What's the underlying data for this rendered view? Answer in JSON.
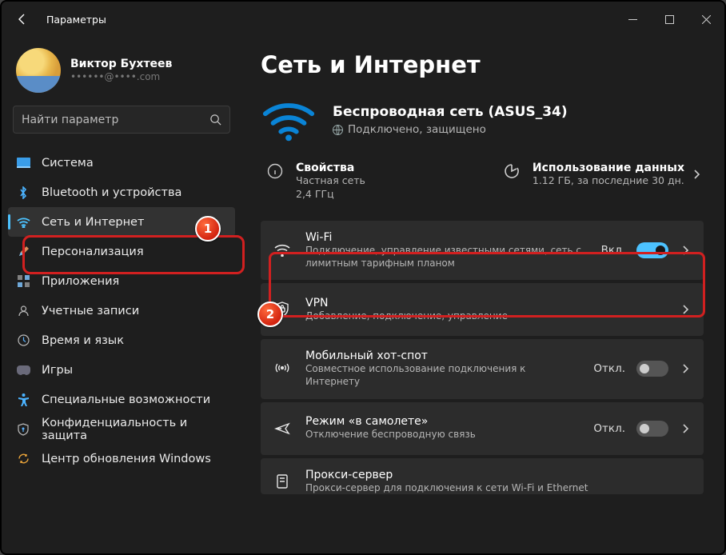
{
  "window": {
    "title": "Параметры"
  },
  "profile": {
    "name": "Виктор Бухтеев",
    "email": "••••••@••••.com"
  },
  "search": {
    "placeholder": "Найти параметр"
  },
  "sidebar": {
    "items": [
      {
        "label": "Система"
      },
      {
        "label": "Bluetooth и устройства"
      },
      {
        "label": "Сеть и Интернет"
      },
      {
        "label": "Персонализация"
      },
      {
        "label": "Приложения"
      },
      {
        "label": "Учетные записи"
      },
      {
        "label": "Время и язык"
      },
      {
        "label": "Игры"
      },
      {
        "label": "Специальные возможности"
      },
      {
        "label": "Конфиденциальность и защита"
      },
      {
        "label": "Центр обновления Windows"
      }
    ]
  },
  "main": {
    "title": "Сеть и Интернет",
    "hero": {
      "title": "Беспроводная сеть (ASUS_34)",
      "sub": "Подключено, защищено"
    },
    "props": {
      "left": {
        "title": "Свойства",
        "line1": "Частная сеть",
        "line2": "2,4 ГГц"
      },
      "right": {
        "title": "Использование данных",
        "line1": "1.12 ГБ, за последние 30 дн."
      }
    },
    "cards": [
      {
        "title": "Wi-Fi",
        "sub": "Подключение, управление известными сетями, сеть с лимитным тарифным планом",
        "state": "Вкл.",
        "toggle": "on"
      },
      {
        "title": "VPN",
        "sub": "Добавление, подключение, управление"
      },
      {
        "title": "Мобильный хот-спот",
        "sub": "Совместное использование подключения к Интернету",
        "state": "Откл.",
        "toggle": "off"
      },
      {
        "title": "Режим «в самолете»",
        "sub": "Отключение беспроводную связь",
        "state": "Откл.",
        "toggle": "off"
      },
      {
        "title": "Прокси-сервер",
        "sub": "Прокси-сервер для подключения к сети Wi-Fi и Ethernet"
      }
    ]
  },
  "annotations": {
    "b1": "1",
    "b2": "2"
  }
}
